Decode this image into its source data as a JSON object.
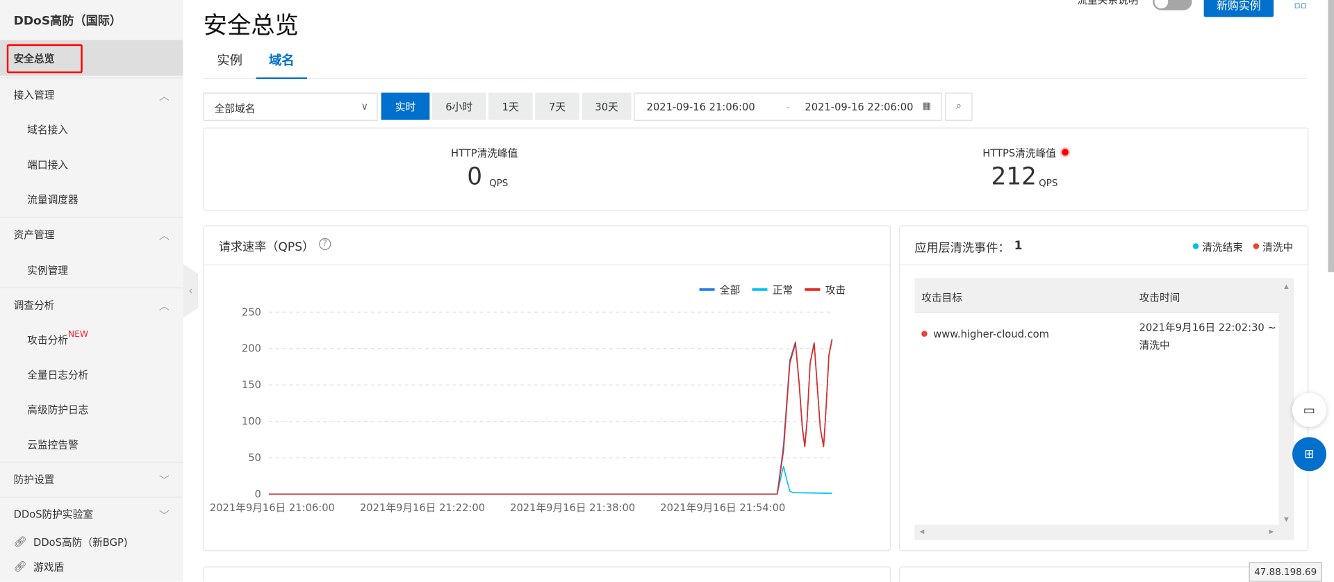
{
  "sidebar": {
    "title": "DDoS高防（国际）",
    "items": [
      {
        "label": "安全总览"
      },
      {
        "label": "接入管理"
      },
      {
        "label": "域名接入"
      },
      {
        "label": "端口接入"
      },
      {
        "label": "流量调度器"
      },
      {
        "label": "资产管理"
      },
      {
        "label": "实例管理"
      },
      {
        "label": "调查分析"
      },
      {
        "label": "攻击分析",
        "badge": "NEW"
      },
      {
        "label": "全量日志分析"
      },
      {
        "label": "高级防护日志"
      },
      {
        "label": "云监控告警"
      },
      {
        "label": "防护设置"
      },
      {
        "label": "DDoS防护实验室"
      },
      {
        "label": "DDoS高防（新BGP)"
      },
      {
        "label": "游戏盾"
      }
    ]
  },
  "header": {
    "title": "安全总览",
    "flow_label": "流量关系说明",
    "buy_button": "新购实例"
  },
  "tabs": [
    {
      "label": "实例"
    },
    {
      "label": "域名"
    }
  ],
  "filters": {
    "domain_select": "全部域名",
    "ranges": [
      "实时",
      "6小时",
      "1天",
      "7天",
      "30天"
    ],
    "start": "2021-09-16 21:06:00",
    "sep": "-",
    "end": "2021-09-16 22:06:00"
  },
  "stats": {
    "http": {
      "label": "HTTP清洗峰值",
      "value": "0",
      "unit": "QPS"
    },
    "https": {
      "label": "HTTPS清洗峰值",
      "value": "212",
      "unit": "QPS"
    }
  },
  "chart_card": {
    "title": "请求速率（QPS）"
  },
  "events": {
    "title": "应用层清洗事件：",
    "count": "1",
    "legend": [
      "清洗结束",
      "清洗中"
    ],
    "colors": {
      "done": "#00c1de",
      "ongoing": "#f04134"
    },
    "columns": [
      "攻击目标",
      "攻击时间"
    ],
    "rows": [
      {
        "target": "www.higher-cloud.com",
        "time": "2021年9月16日 22:02:30 ~",
        "status": "清洗中"
      }
    ]
  },
  "ip_badge": "47.88.198.69",
  "chart_data": {
    "type": "line",
    "title": "请求速率（QPS）",
    "ylim": [
      0,
      250
    ],
    "yticks": [
      "0",
      "50",
      "100",
      "150",
      "200",
      "250"
    ],
    "x_range": [
      "21:06:00",
      "22:06:00"
    ],
    "xticks": [
      {
        "t": "21:06:00",
        "label": "2021年9月16日 21:06:00"
      },
      {
        "t": "21:22:00",
        "label": "2021年9月16日 21:22:00"
      },
      {
        "t": "21:38:00",
        "label": "2021年9月16日 21:38:00"
      },
      {
        "t": "21:54:00",
        "label": "2021年9月16日 21:54:00"
      }
    ],
    "series": [
      {
        "name": "全部",
        "color": "#1f7ee8",
        "points": [
          [
            "21:06:00",
            0
          ],
          [
            "22:00:10",
            0
          ],
          [
            "22:00:40",
            50
          ],
          [
            "22:00:50",
            68
          ],
          [
            "22:01:30",
            184
          ],
          [
            "22:02:06",
            209
          ],
          [
            "22:02:30",
            152
          ],
          [
            "22:02:50",
            92
          ],
          [
            "22:03:06",
            66
          ],
          [
            "22:03:20",
            101
          ],
          [
            "22:03:40",
            181
          ],
          [
            "22:04:06",
            208
          ],
          [
            "22:04:25",
            151
          ],
          [
            "22:04:45",
            91
          ],
          [
            "22:05:06",
            66
          ],
          [
            "22:05:20",
            111
          ],
          [
            "22:05:40",
            191
          ],
          [
            "22:06:00",
            213
          ]
        ]
      },
      {
        "name": "正常",
        "color": "#00c1f3",
        "points": [
          [
            "21:06:00",
            0
          ],
          [
            "22:00:10",
            0
          ],
          [
            "22:00:40",
            30
          ],
          [
            "22:00:50",
            38
          ],
          [
            "22:01:10",
            20
          ],
          [
            "22:01:30",
            4
          ],
          [
            "22:01:50",
            2
          ],
          [
            "22:06:00",
            1
          ]
        ]
      },
      {
        "name": "攻击",
        "color": "#e8261c",
        "points": [
          [
            "21:06:00",
            0
          ],
          [
            "22:00:10",
            0
          ],
          [
            "22:00:50",
            60
          ],
          [
            "22:01:30",
            180
          ],
          [
            "22:02:06",
            207
          ],
          [
            "22:02:30",
            150
          ],
          [
            "22:02:50",
            90
          ],
          [
            "22:03:06",
            65
          ],
          [
            "22:03:20",
            100
          ],
          [
            "22:03:40",
            180
          ],
          [
            "22:04:06",
            207
          ],
          [
            "22:04:25",
            150
          ],
          [
            "22:04:45",
            90
          ],
          [
            "22:05:06",
            65
          ],
          [
            "22:05:20",
            110
          ],
          [
            "22:05:40",
            190
          ],
          [
            "22:06:00",
            212
          ]
        ]
      }
    ]
  }
}
